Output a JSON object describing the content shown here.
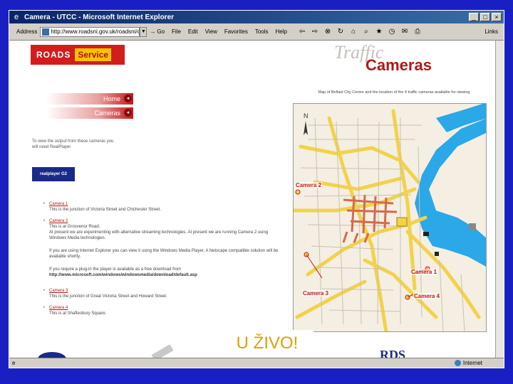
{
  "window": {
    "title": "Camera - UTCC - Microsoft Internet Explorer",
    "controls": {
      "minimize": "_",
      "maximize": "□",
      "close": "×"
    }
  },
  "toolbar": {
    "address_label": "Address",
    "address_value": "http://www.roadsni.gov.uk/roadsni/c",
    "go_label": "Go",
    "menus": [
      "File",
      "Edit",
      "View",
      "Favorites",
      "Tools",
      "Help"
    ],
    "links_label": "Links"
  },
  "status": {
    "zone": "Internet"
  },
  "page": {
    "logo_roads": "ROADS",
    "logo_service": "Service",
    "title_traffic": "Traffic",
    "title_cameras": "Cameras",
    "nav": [
      {
        "label": "Home"
      },
      {
        "label": "Cameras"
      }
    ],
    "intro": "To view the output from these cameras you will need RealPlayer",
    "realplayer_label": "realplayer G2",
    "cameras": [
      {
        "link": "Camera 1",
        "text": "This is the junction of Victoria Street and Chichester Street."
      },
      {
        "link": "Camera 2",
        "text": "This is at Grosvenor Road.",
        "extra": "At present we are experimenting with alternative streaming technologies. At present we are running Camera 2 using Windows Media technologies.",
        "extra2": "If you are using Internet Explorer you can view it using the Windows Media Player. A Netscape compatible solution will be available shortly.",
        "extra3": "If you require a plug-in the player is available as a free download from",
        "url": "http://www.microsoft.com/windows/windowsmedia/download/default.asp"
      },
      {
        "link": "Camera 3",
        "text": "This is the junction of Great Victoria Street and Howard Street."
      },
      {
        "link": "Camera 4",
        "text": "This is at Shaftesbury Square."
      }
    ],
    "map_caption": "Map of Belfast City Centre and the location of the 4 traffic cameras available for viewing",
    "map_labels": [
      "Camera 2",
      "Camera 1",
      "Camera 3",
      "Camera 4"
    ],
    "footer_rds": "RDS",
    "overlay_text": "U ŽIVO!"
  },
  "colors": {
    "background": "#1a1fc4",
    "roads_red": "#d21d1d",
    "service_yellow": "#f5c400",
    "overlay_text": "#e0a000"
  }
}
